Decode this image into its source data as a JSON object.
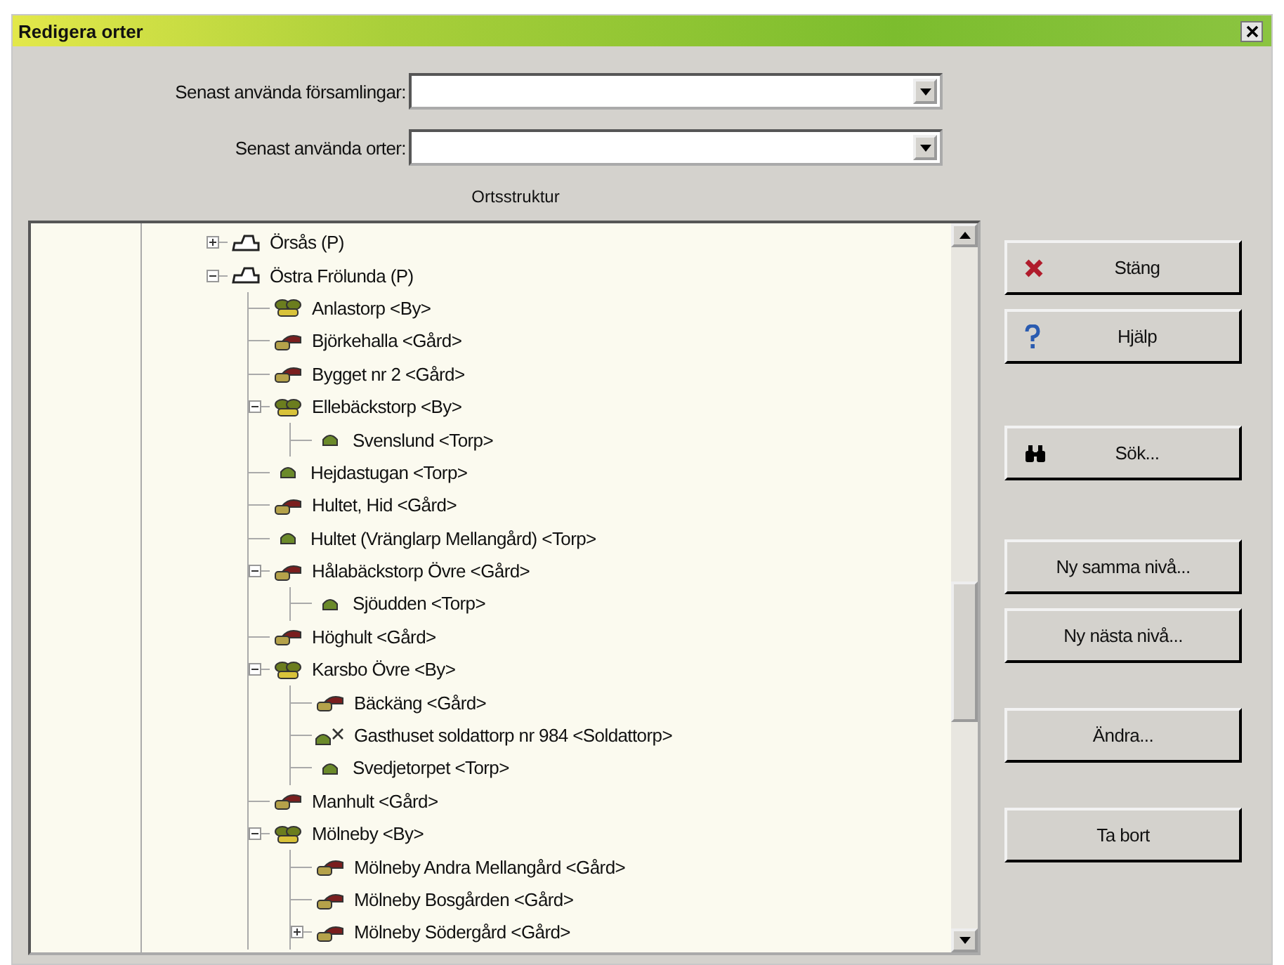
{
  "window": {
    "title": "Redigera orter"
  },
  "fields": [
    {
      "label": "Senast använda församlingar:"
    },
    {
      "label": "Senast använda orter:"
    }
  ],
  "tree": {
    "title": "Ortsstruktur",
    "items": [
      {
        "label": "Örsås (P)",
        "kind": "parish",
        "expanded": false
      },
      {
        "label": "Östra Frölunda (P)",
        "kind": "parish",
        "expanded": true,
        "children": [
          {
            "label": "Anlastorp <By>",
            "kind": "village"
          },
          {
            "label": "Björkehalla <Gård>",
            "kind": "farm"
          },
          {
            "label": "Bygget nr 2 <Gård>",
            "kind": "farm"
          },
          {
            "label": "Ellebäckstorp <By>",
            "kind": "village",
            "expanded": true,
            "children": [
              {
                "label": "Svenslund <Torp>",
                "kind": "croft"
              }
            ]
          },
          {
            "label": "Hejdastugan <Torp>",
            "kind": "croft"
          },
          {
            "label": "Hultet, Hid <Gård>",
            "kind": "farm"
          },
          {
            "label": "Hultet (Vränglarp Mellangård) <Torp>",
            "kind": "croft"
          },
          {
            "label": "Hålabäckstorp Övre <Gård>",
            "kind": "farm",
            "expanded": true,
            "children": [
              {
                "label": "Sjöudden <Torp>",
                "kind": "croft"
              }
            ]
          },
          {
            "label": "Höghult <Gård>",
            "kind": "farm"
          },
          {
            "label": "Karsbo Övre <By>",
            "kind": "village",
            "expanded": true,
            "children": [
              {
                "label": "Bäckäng <Gård>",
                "kind": "farm"
              },
              {
                "label": "Gasthuset soldattorp nr 984 <Soldattorp>",
                "kind": "soldier"
              },
              {
                "label": "Svedjetorpet <Torp>",
                "kind": "croft"
              }
            ]
          },
          {
            "label": "Manhult <Gård>",
            "kind": "farm"
          },
          {
            "label": "Mölneby <By>",
            "kind": "village",
            "expanded": true,
            "children": [
              {
                "label": "Mölneby Andra Mellangård <Gård>",
                "kind": "farm"
              },
              {
                "label": "Mölneby Bosgården <Gård>",
                "kind": "farm"
              },
              {
                "label": "Mölneby Södergård <Gård>",
                "kind": "farm",
                "expanded": false
              }
            ]
          }
        ]
      }
    ]
  },
  "buttons": [
    {
      "label": "Stäng",
      "kind": "close"
    },
    {
      "label": "Hjälp",
      "kind": "help"
    },
    {
      "label": "Sök...",
      "kind": "search"
    },
    {
      "label": "Ny samma nivå...",
      "kind": "plain"
    },
    {
      "label": "Ny nästa nivå...",
      "kind": "plain"
    },
    {
      "label": "Ändra...",
      "kind": "plain"
    },
    {
      "label": "Ta bort",
      "kind": "plain"
    }
  ]
}
